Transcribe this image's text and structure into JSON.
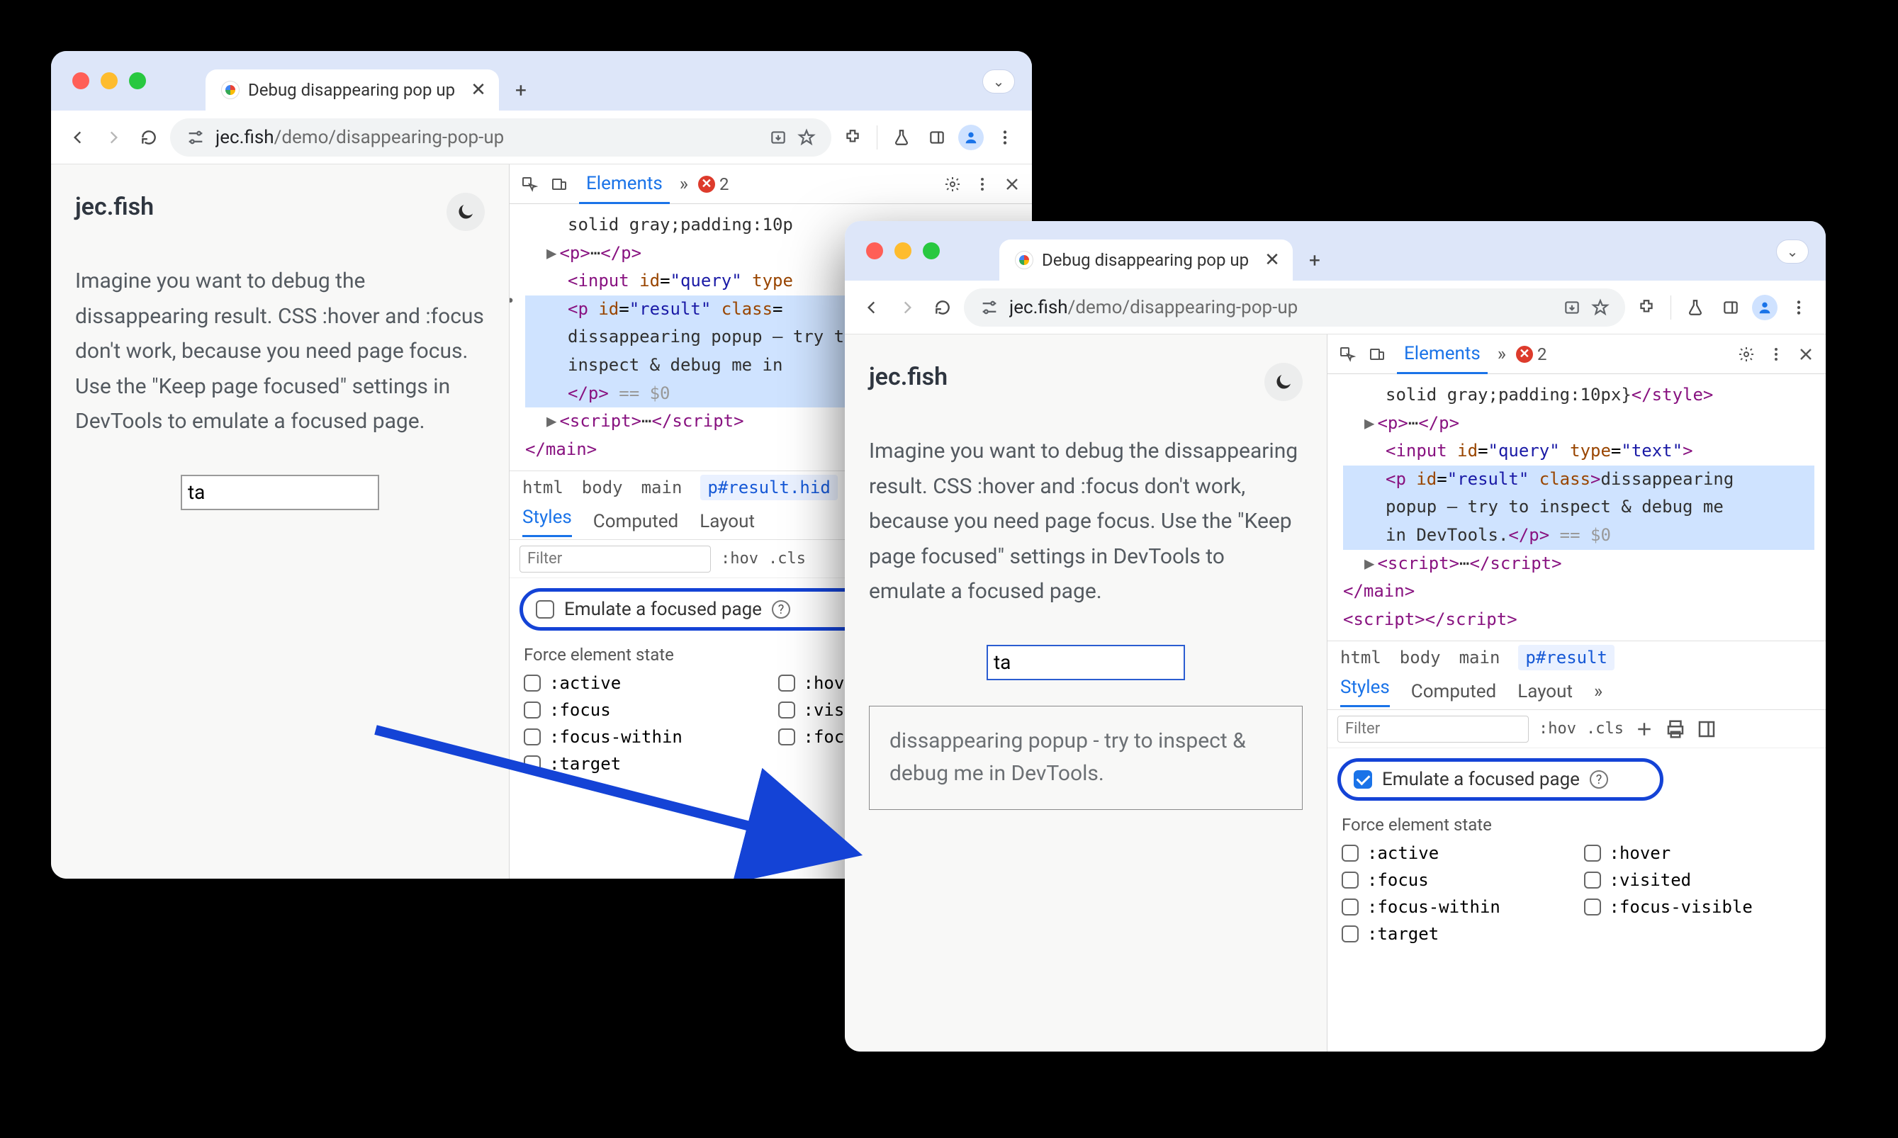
{
  "tab": {
    "title": "Debug disappearing pop up"
  },
  "url": {
    "host": "jec.fish",
    "path": "/demo/disappearing-pop-up"
  },
  "page": {
    "site_title": "jec.fish",
    "description": "Imagine you want to debug the dissappearing result. CSS :hover and :focus don't work, because you need page focus. Use the \"Keep page focused\" settings in DevTools to emulate a focused page.",
    "query_value": "ta",
    "popup_text": "dissappearing popup - try to inspect & debug me in DevTools."
  },
  "devtools": {
    "panel": "Elements",
    "error_count": "2",
    "dom_style_frag": "solid gray;padding:10p",
    "dom_style_frag2": "solid gray;padding:10px}",
    "dom_result_text": "dissappearing popup – try to inspect & debug me in",
    "dom_result_text_w2": "dissappearing popup – try to inspect & debug me in DevTools.",
    "eq0": "== $0",
    "crumbs": {
      "c1": "html",
      "c2": "body",
      "c3": "main",
      "c4_w1": "p#result.hid",
      "c4_w2": "p#result"
    },
    "style_tabs": {
      "t1": "Styles",
      "t2": "Computed",
      "t3": "Layout"
    },
    "filter_placeholder": "Filter",
    "hov": ":hov",
    "cls": ".cls",
    "emulate_label": "Emulate a focused page",
    "force_label": "Force element state",
    "states": {
      "active": ":active",
      "hover": ":hover",
      "focus": ":focus",
      "visited": ":visited",
      "focus_within": ":focus-within",
      "focus_visible": ":focus-visible",
      "target": ":target",
      "visi_frag": ":visi",
      "focu_frag": ":focu",
      "hove_frag": ":hove"
    }
  }
}
